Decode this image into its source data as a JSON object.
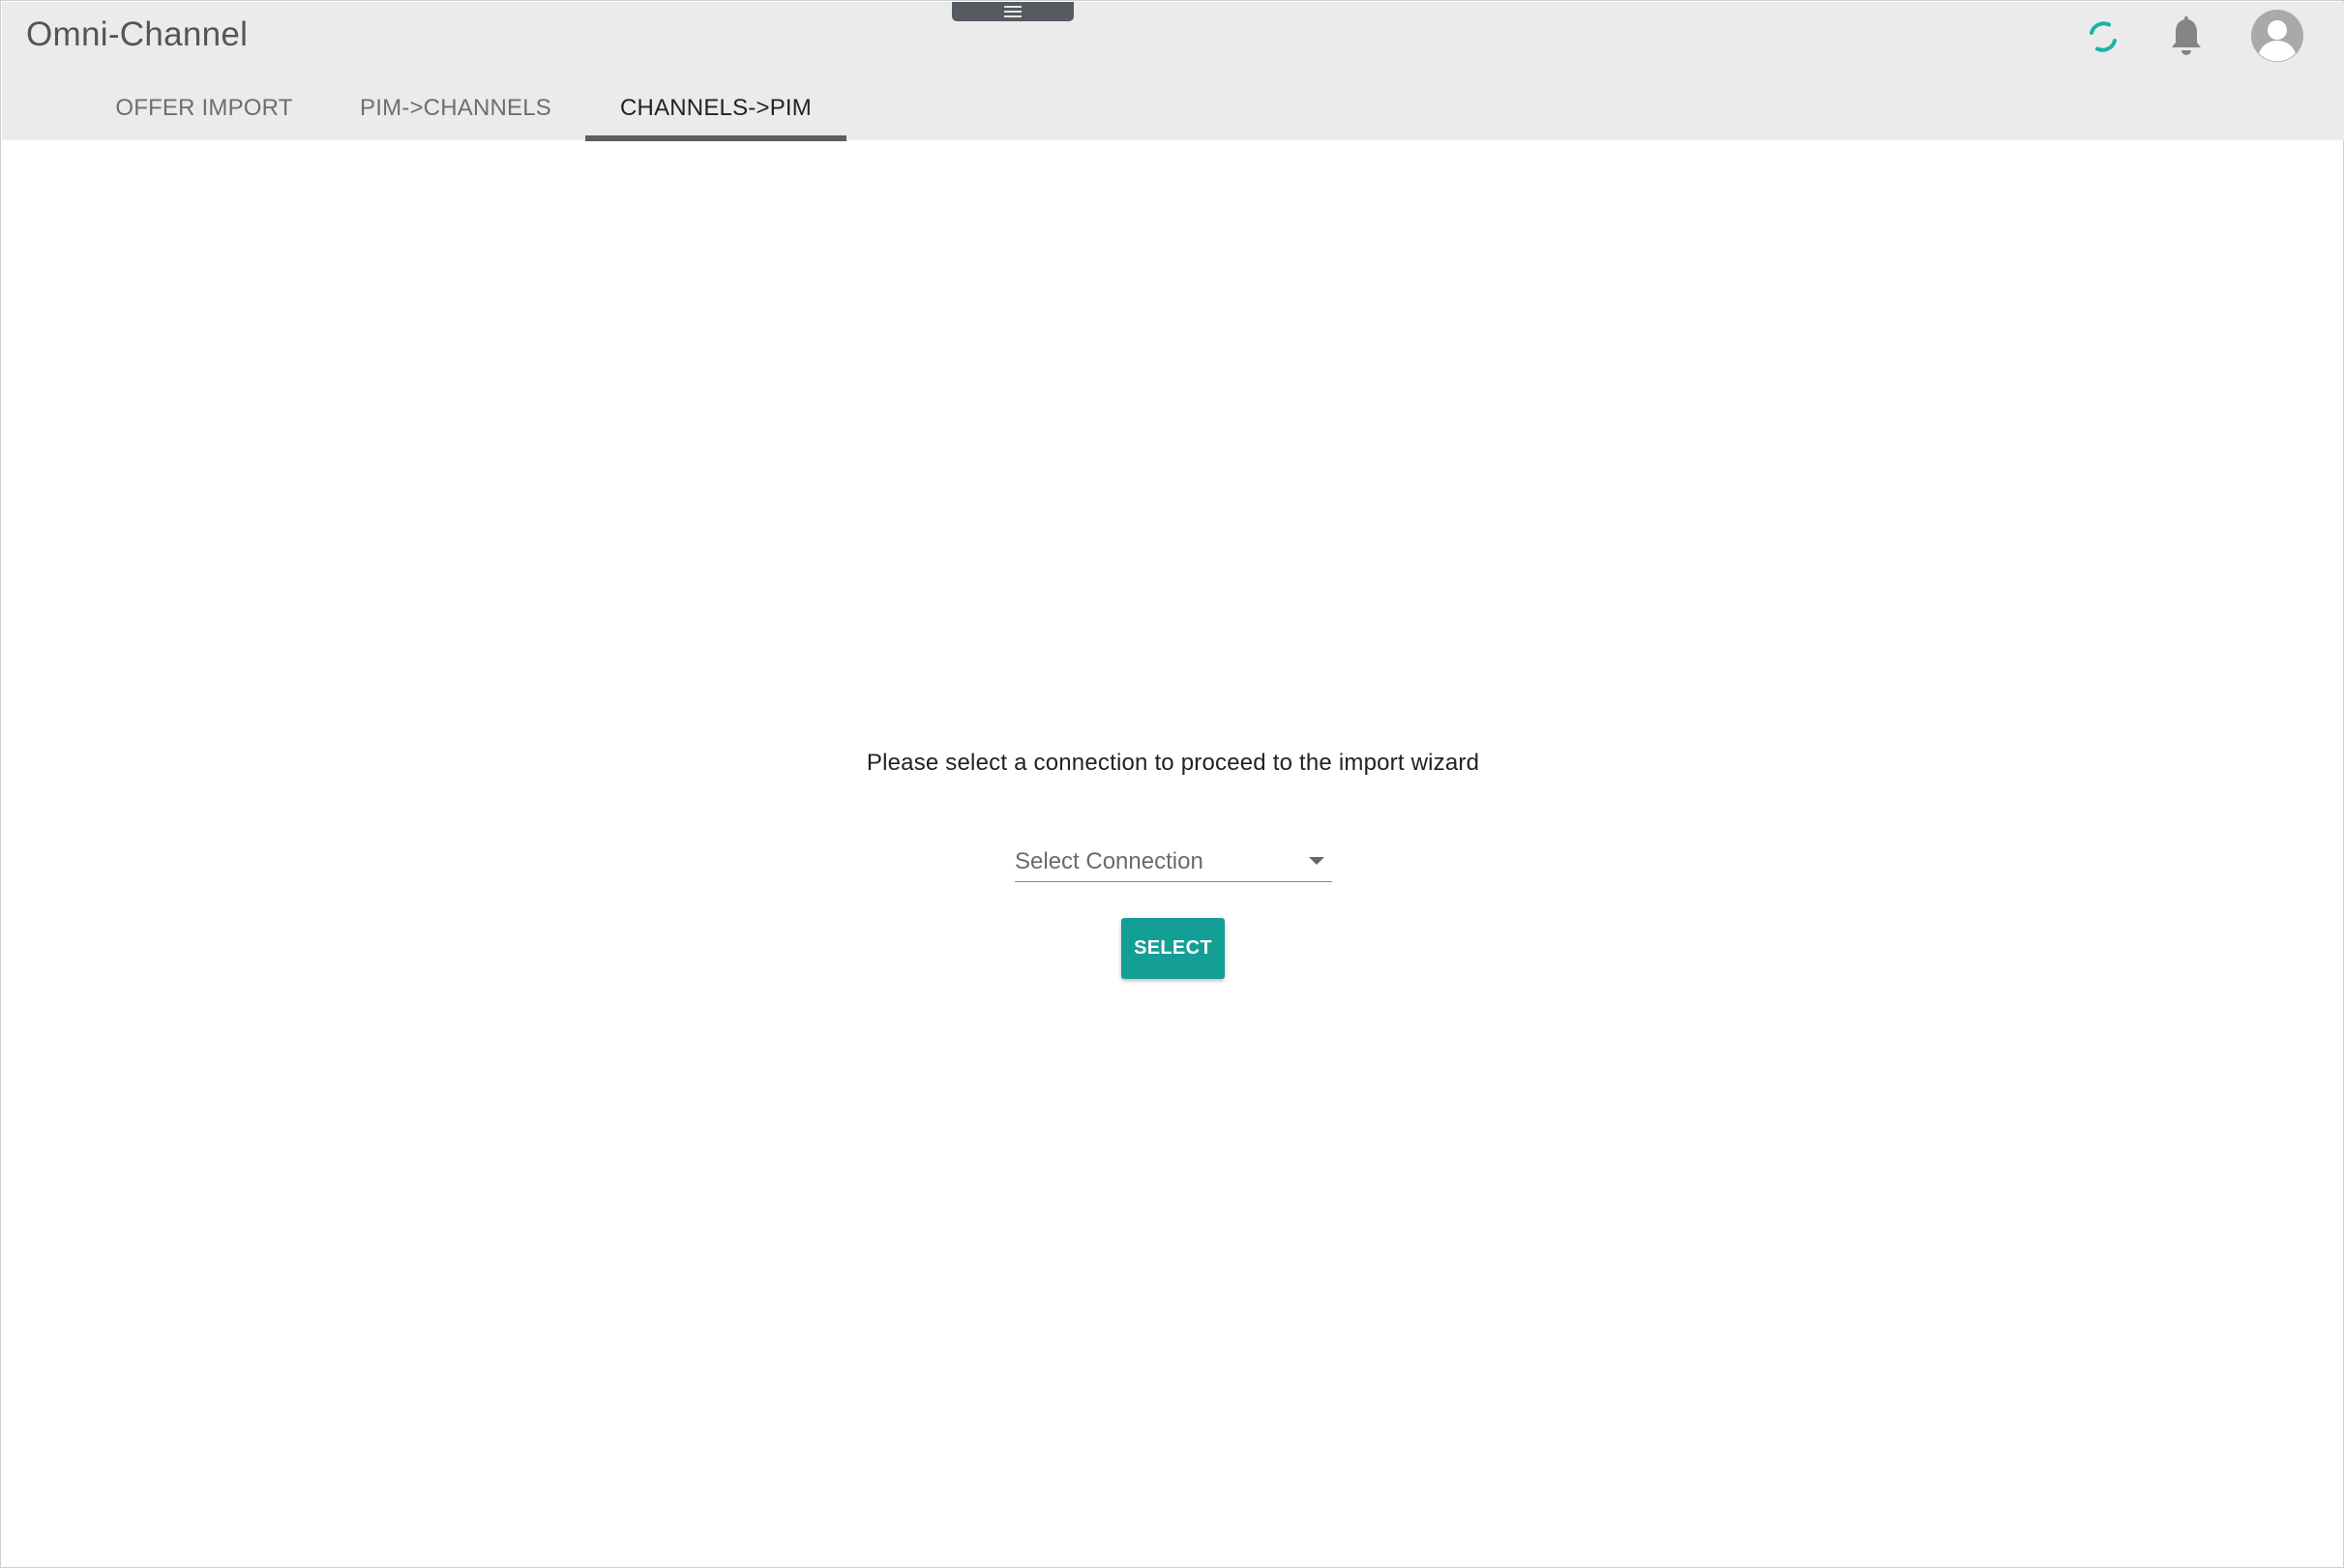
{
  "app": {
    "title": "Omni-Channel"
  },
  "header": {
    "menu_icon": "hamburger-menu-icon",
    "sync_icon": "sync-spinner-icon",
    "notifications_icon": "bell-icon",
    "avatar_icon": "user-avatar-icon"
  },
  "tabs": [
    {
      "label": "OFFER IMPORT",
      "active": false
    },
    {
      "label": "PIM->CHANNELS",
      "active": false
    },
    {
      "label": "CHANNELS->PIM",
      "active": true
    }
  ],
  "main": {
    "prompt": "Please select a connection to proceed to the import wizard",
    "select": {
      "placeholder": "Select Connection",
      "value": ""
    },
    "select_button_label": "SELECT"
  },
  "colors": {
    "header_background": "#ebebeb",
    "accent_teal": "#139e96",
    "tab_indicator": "#5a5f63",
    "menu_handle": "#555b60"
  }
}
